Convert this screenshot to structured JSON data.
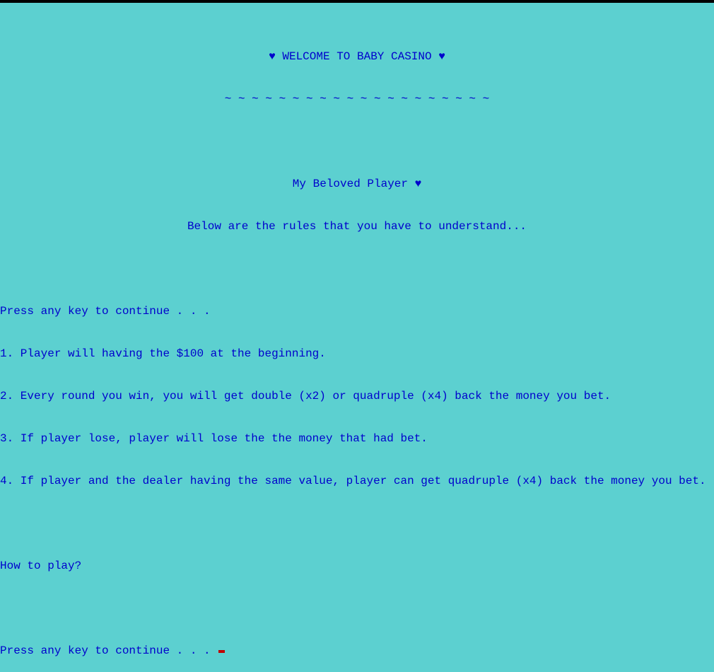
{
  "header": {
    "title": "♥ WELCOME TO BABY CASINO ♥",
    "divider": "~ ~ ~ ~ ~ ~ ~ ~ ~ ~ ~ ~ ~ ~ ~ ~ ~ ~ ~ ~",
    "greeting": "My Beloved Player ♥",
    "intro": "Below are the rules that you have to understand..."
  },
  "prompts": {
    "continue1": "Press any key to continue . . .",
    "continue2": "Press any key to continue . . . "
  },
  "rules": {
    "r1": "1. Player will having the $100 at the beginning.",
    "r2": "2. Every round you win, you will get double (x2) or quadruple (x4) back the money you bet.",
    "r3": "3. If player lose, player will lose the the money that had bet.",
    "r4": "4. If player and the dealer having the same value, player can get quadruple (x4) back the money you bet."
  },
  "howto": "How to play?"
}
